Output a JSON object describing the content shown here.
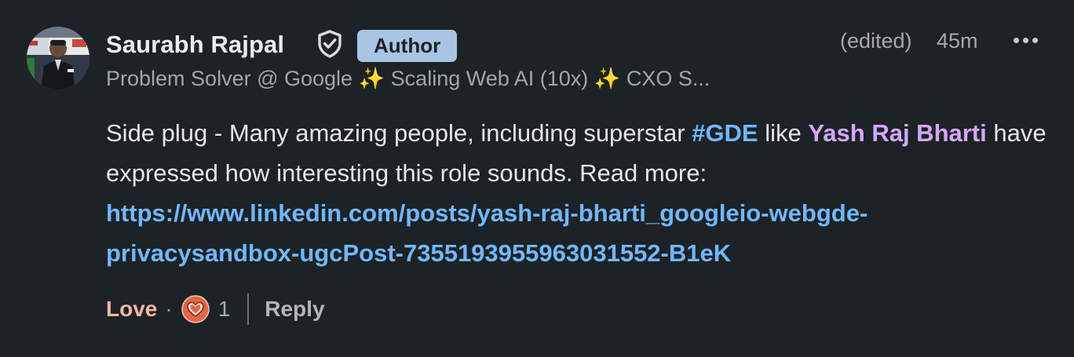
{
  "author": {
    "name": "Saurabh Rajpal",
    "badge": "Author",
    "headline": "Problem Solver @ Google ✨ Scaling Web AI (10x) ✨ CXO S..."
  },
  "meta": {
    "edited": "(edited)",
    "time": "45m"
  },
  "body": {
    "part1": "Side plug - Many amazing people, including superstar ",
    "hashtag": "#GDE",
    "part2": " like ",
    "mention": "Yash Raj Bharti",
    "part3": " have expressed how interesting this role sounds. Read more: ",
    "link": "https://www.linkedin.com/posts/yash-raj-bharti_googleio-webgde-privacysandbox-ugcPost-7355193955963031552-B1eK"
  },
  "actions": {
    "reaction_label": "Love",
    "separator": "·",
    "reaction_count": "1",
    "reply_label": "Reply"
  },
  "icons": {
    "verified": "shield-check-icon",
    "more": "more-options-icon",
    "reaction": "love-heart-icon"
  },
  "colors": {
    "background": "#1d2226",
    "badge": "#a8c5e3",
    "link": "#71b7fb",
    "mention": "#d4a8f8",
    "love": "#f3b8a3",
    "reaction_icon": "#e16745"
  }
}
